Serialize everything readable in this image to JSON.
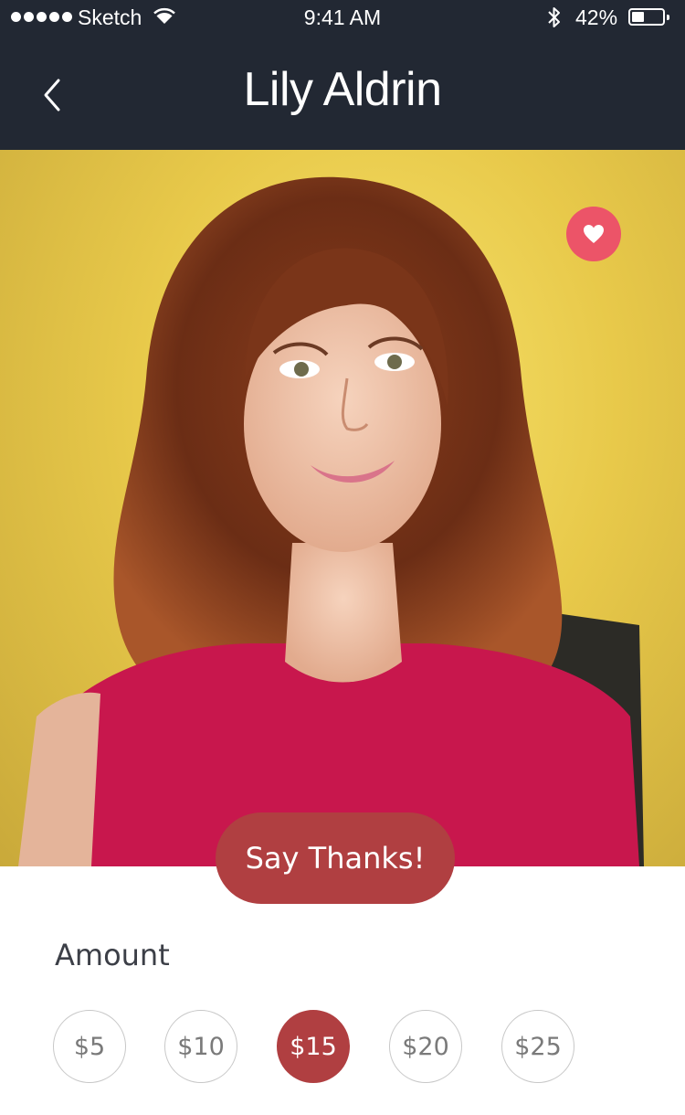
{
  "status_bar": {
    "carrier": "Sketch",
    "time": "9:41 AM",
    "battery_percent": "42%",
    "battery_level": 0.42
  },
  "nav": {
    "title": "Lily Aldrin",
    "back_icon": "chevron-left-icon"
  },
  "profile": {
    "favorite_icon": "heart-icon",
    "favorite_color": "#ec5468"
  },
  "cta": {
    "label": "Say Thanks!",
    "color": "#b03f41"
  },
  "amount": {
    "label": "Amount",
    "options": [
      "$5",
      "$10",
      "$15",
      "$20",
      "$25"
    ],
    "selected": "$15"
  },
  "colors": {
    "header_bg": "#222833",
    "accent": "#b03f41"
  }
}
